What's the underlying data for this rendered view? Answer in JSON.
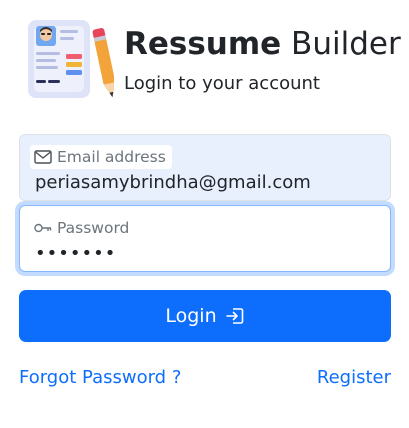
{
  "header": {
    "title_brand": "Ressume",
    "title_rest": " Builder",
    "subtitle": "Login to your account",
    "logo_icon": "resume-logo-icon"
  },
  "form": {
    "email": {
      "label": "Email address",
      "value": "periasamybrindha@gmail.com",
      "icon": "envelope-icon"
    },
    "password": {
      "label": "Password",
      "masked_value": "•••••••",
      "icon": "key-icon"
    },
    "login_button": {
      "label": "Login",
      "icon": "login-arrow-icon"
    }
  },
  "links": {
    "forgot_password": "Forgot Password ?",
    "register": "Register"
  },
  "colors": {
    "primary": "#0d6efd",
    "autofill_bg": "#e8f0fe",
    "muted_text": "#6c757d"
  }
}
